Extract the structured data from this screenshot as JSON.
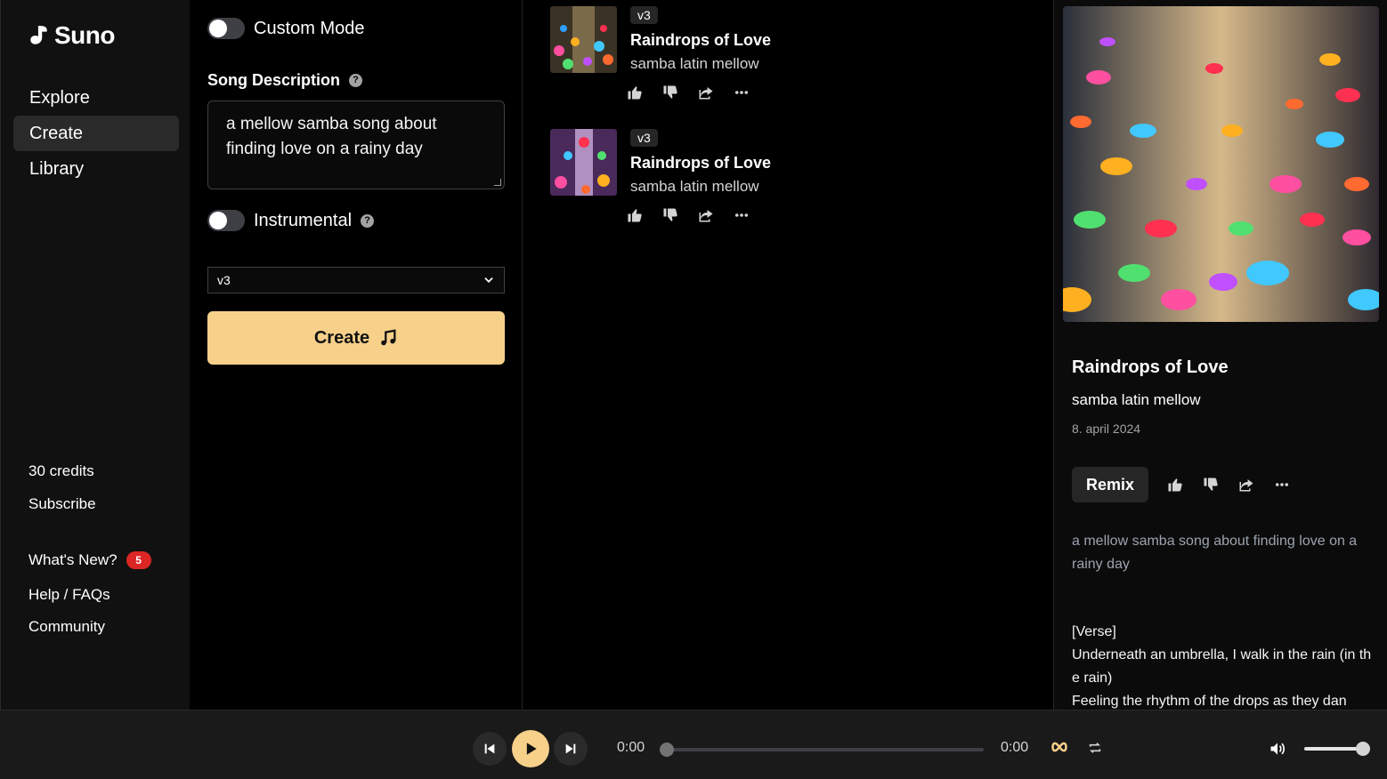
{
  "app": {
    "name": "Suno"
  },
  "sidebar": {
    "nav": [
      {
        "label": "Explore"
      },
      {
        "label": "Create",
        "active": true
      },
      {
        "label": "Library"
      }
    ],
    "credits": "30 credits",
    "subscribe": "Subscribe",
    "whats_new": "What's New?",
    "whats_new_count": "5",
    "help": "Help / FAQs",
    "community": "Community"
  },
  "create": {
    "custom_mode_label": "Custom Mode",
    "custom_mode_on": false,
    "song_description_label": "Song Description",
    "song_description_value": "a mellow samba song about finding love on a rainy day",
    "instrumental_label": "Instrumental",
    "instrumental_on": false,
    "model_selected": "v3",
    "create_button": "Create"
  },
  "songs": [
    {
      "version": "v3",
      "title": "Raindrops of Love",
      "tags": "samba latin mellow"
    },
    {
      "version": "v3",
      "title": "Raindrops of Love",
      "tags": "samba latin mellow"
    }
  ],
  "details": {
    "title": "Raindrops of Love",
    "tags": "samba latin mellow",
    "date": "8. april 2024",
    "remix_label": "Remix",
    "prompt": "a mellow samba song about finding love on a rainy day",
    "lyrics": "[Verse]\nUnderneath an umbrella, I walk in the rain (in the rain)\nFeeling the rhythm of the drops as they dan"
  },
  "player": {
    "current_time": "0:00",
    "total_time": "0:00",
    "progress": 0,
    "volume": 1.0
  },
  "colors": {
    "accent": "#f7d08a",
    "badge": "#dc2626"
  }
}
